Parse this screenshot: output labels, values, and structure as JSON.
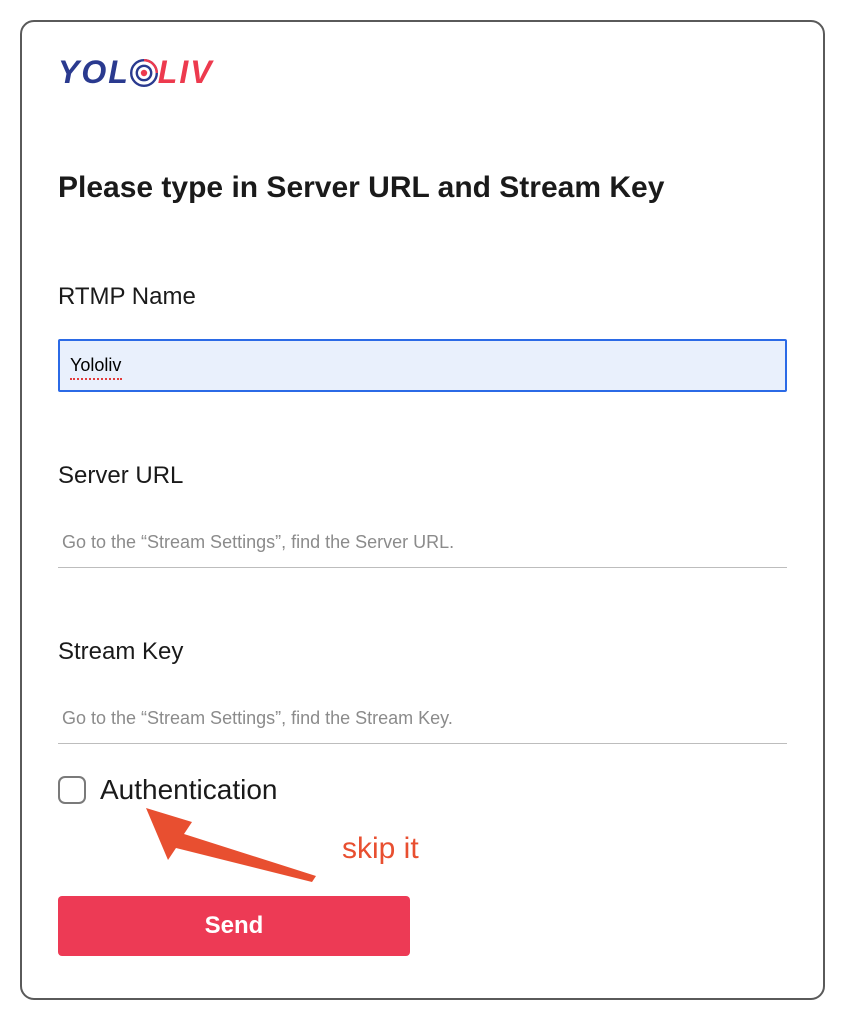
{
  "logo": {
    "brand_left": "YOL",
    "brand_right": "LIV"
  },
  "title": "Please type in Server URL and Stream Key",
  "form": {
    "rtmp": {
      "label": "RTMP Name",
      "value": "Yololiv"
    },
    "server_url": {
      "label": "Server URL",
      "placeholder": "Go to the “Stream Settings”, find the Server URL."
    },
    "stream_key": {
      "label": "Stream Key",
      "placeholder": "Go to the “Stream Settings”, find the Stream Key."
    },
    "authentication": {
      "label": "Authentication",
      "checked": false
    },
    "submit_label": "Send"
  },
  "annotation": {
    "text": "skip it"
  }
}
